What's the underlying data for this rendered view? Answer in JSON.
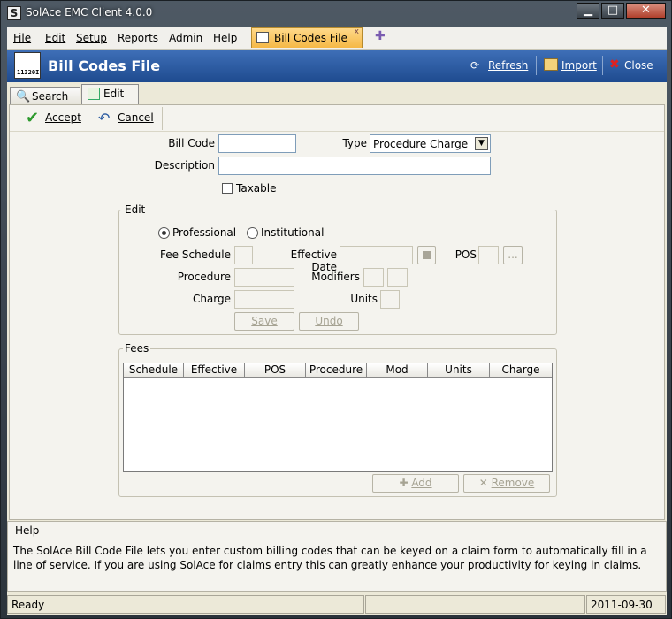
{
  "window": {
    "title": "SolAce EMC Client 4.0.0",
    "app_icon_letter": "S",
    "minimize": "▁",
    "maximize": "□",
    "close": "✕"
  },
  "menu": {
    "items": [
      "File",
      "Edit",
      "Setup",
      "Reports",
      "Admin",
      "Help"
    ]
  },
  "doc_tab": {
    "label": "Bill Codes File",
    "close": "x",
    "add": "✚"
  },
  "header": {
    "title": "Bill Codes File",
    "icon_text": "11320I",
    "refresh": "Refresh",
    "import": "Import",
    "close": "Close"
  },
  "tabs": {
    "search": "Search",
    "edit": "Edit"
  },
  "toolbar": {
    "accept": "Accept",
    "cancel": "Cancel"
  },
  "form": {
    "bill_code_label": "Bill Code",
    "bill_code_value": "",
    "type_label": "Type",
    "type_value": "Procedure Charge",
    "description_label": "Description",
    "description_value": "",
    "taxable_label": "Taxable",
    "taxable_checked": false
  },
  "edit_group": {
    "title": "Edit",
    "professional": "Professional",
    "institutional": "Institutional",
    "selected": "professional",
    "fee_schedule": "Fee Schedule",
    "effective_date": "Effective Date",
    "pos": "POS",
    "procedure": "Procedure",
    "modifiers": "Modifiers",
    "charge": "Charge",
    "units": "Units",
    "ellipsis": "...",
    "save": "Save",
    "undo": "Undo"
  },
  "fees_group": {
    "title": "Fees",
    "columns": [
      "Schedule",
      "Effective",
      "POS",
      "Procedure",
      "Mod",
      "Units",
      "Charge"
    ],
    "rows": [],
    "add": "Add",
    "remove": "Remove"
  },
  "help": {
    "title": "Help",
    "text": "The SolAce Bill Code File lets you enter custom billing codes that can be keyed on a claim form to automatically fill in a line of service. If you are using SolAce for claims entry this can greatly enhance your productivity for keying in claims."
  },
  "status": {
    "text": "Ready",
    "middle": "",
    "date": "2011-09-30"
  },
  "colors": {
    "header": "#2d5ea6",
    "doc_tab": "#f5c35a",
    "accept": "#2e9a2e",
    "close_x": "#d02020"
  }
}
